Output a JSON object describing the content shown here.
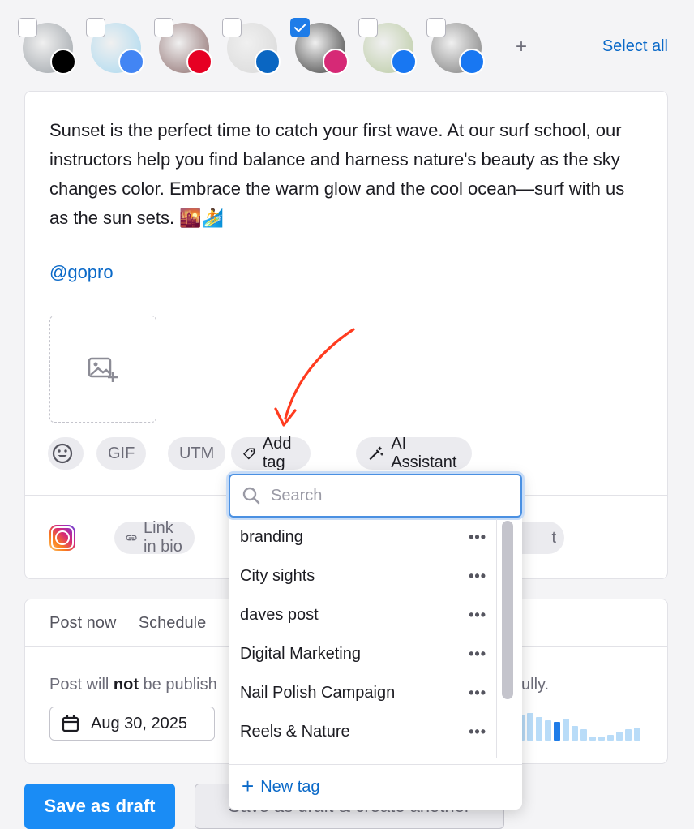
{
  "accounts": [
    {
      "name": "tiktok-account",
      "badge": "tiktok-icon",
      "color": "#000000",
      "checked": false
    },
    {
      "name": "google-business-account",
      "badge": "google-business-icon",
      "color": "#4285f4",
      "checked": false
    },
    {
      "name": "pinterest-account",
      "badge": "pinterest-icon",
      "color": "#e60023",
      "checked": false
    },
    {
      "name": "linkedin-account",
      "badge": "linkedin-icon",
      "color": "#0a66c2",
      "checked": false
    },
    {
      "name": "instagram-account",
      "badge": "instagram-icon",
      "color": "#d62976",
      "checked": true
    },
    {
      "name": "facebook-account-1",
      "badge": "facebook-icon",
      "color": "#1877f2",
      "checked": false
    },
    {
      "name": "facebook-account-2",
      "badge": "facebook-icon",
      "color": "#1877f2",
      "checked": false
    }
  ],
  "header": {
    "add_label": "+",
    "select_all": "Select all"
  },
  "composer": {
    "text": "Sunset is the perfect time to catch your first wave. At our surf school, our instructors help you find balance and harness nature's beauty as the sky changes color. Embrace the warm glow and the cool ocean—surf with us as the sun sets. 🌇🏄",
    "mention": "@gopro",
    "tools": {
      "gif": "GIF",
      "utm": "UTM",
      "add_tag": "Add tag",
      "ai_assistant": "AI Assistant"
    },
    "instagram": {
      "link_in_bio": "Link in bio",
      "hidden_tail": "t"
    }
  },
  "schedule": {
    "tabs": [
      "Post now",
      "Schedule"
    ],
    "notice_prefix": "Post will ",
    "notice_bold": "not",
    "notice_mid": " be publish",
    "notice_tail": "ully.",
    "date": "Aug 30, 2025",
    "bars": [
      0.9,
      0.95,
      0.8,
      0.7,
      0.65,
      0.75,
      0.5,
      0.4,
      0.15,
      0.15,
      0.2,
      0.3,
      0.4,
      0.45
    ],
    "bar_highlight_index": 4
  },
  "buttons": {
    "save_draft": "Save as draft",
    "save_and_create": "Save as draft & create another"
  },
  "tag_dropdown": {
    "search_placeholder": "Search",
    "tags": [
      "branding",
      "City sights",
      "daves post",
      "Digital Marketing",
      "Nail Polish Campaign",
      "Reels & Nature"
    ],
    "more_label": "•••",
    "new_tag": "New tag"
  },
  "colors": {
    "accent": "#1a8cf5",
    "link": "#0a69c8",
    "annotation_arrow": "#ff3b1f"
  }
}
